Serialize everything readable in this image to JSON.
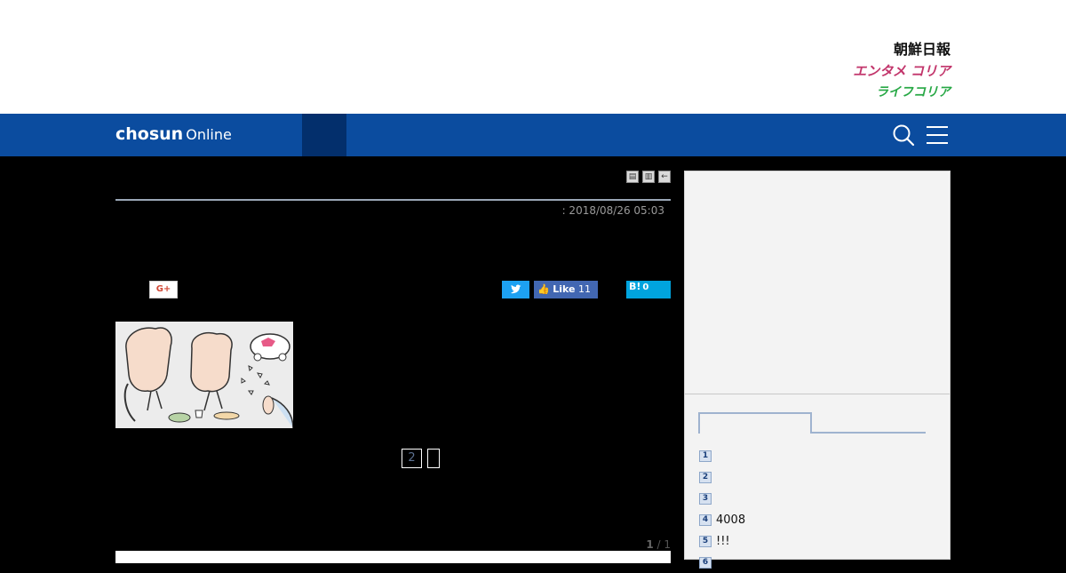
{
  "header": {
    "brand_links": [
      "朝鮮日報",
      "エンタメ コリア",
      "ライフコリア"
    ],
    "brand_colors": {
      "entame": "#c2356b",
      "life": "#27a845"
    }
  },
  "nav": {
    "logo_bold": "chosun",
    "logo_light": "Online",
    "bg_color": "#0b4c9f",
    "icons": [
      "search-icon",
      "menu-icon"
    ]
  },
  "article": {
    "date": ": 2018/08/26 05:03",
    "social": {
      "gplus": "G+",
      "fb_like_label": "Like",
      "fb_like_count": "11",
      "hatena_label": "B!",
      "hatena_count": "0"
    },
    "pager": {
      "page_2": "2"
    },
    "page_count_current": "1",
    "page_count_total": "/ 1"
  },
  "sidebar": {
    "ranking": [
      {
        "num": "1",
        "text": ""
      },
      {
        "num": "2",
        "text": ""
      },
      {
        "num": "3",
        "text": ""
      },
      {
        "num": "4",
        "text": "4008"
      },
      {
        "num": "5",
        "text": "!!!"
      },
      {
        "num": "6",
        "text": ""
      }
    ]
  }
}
